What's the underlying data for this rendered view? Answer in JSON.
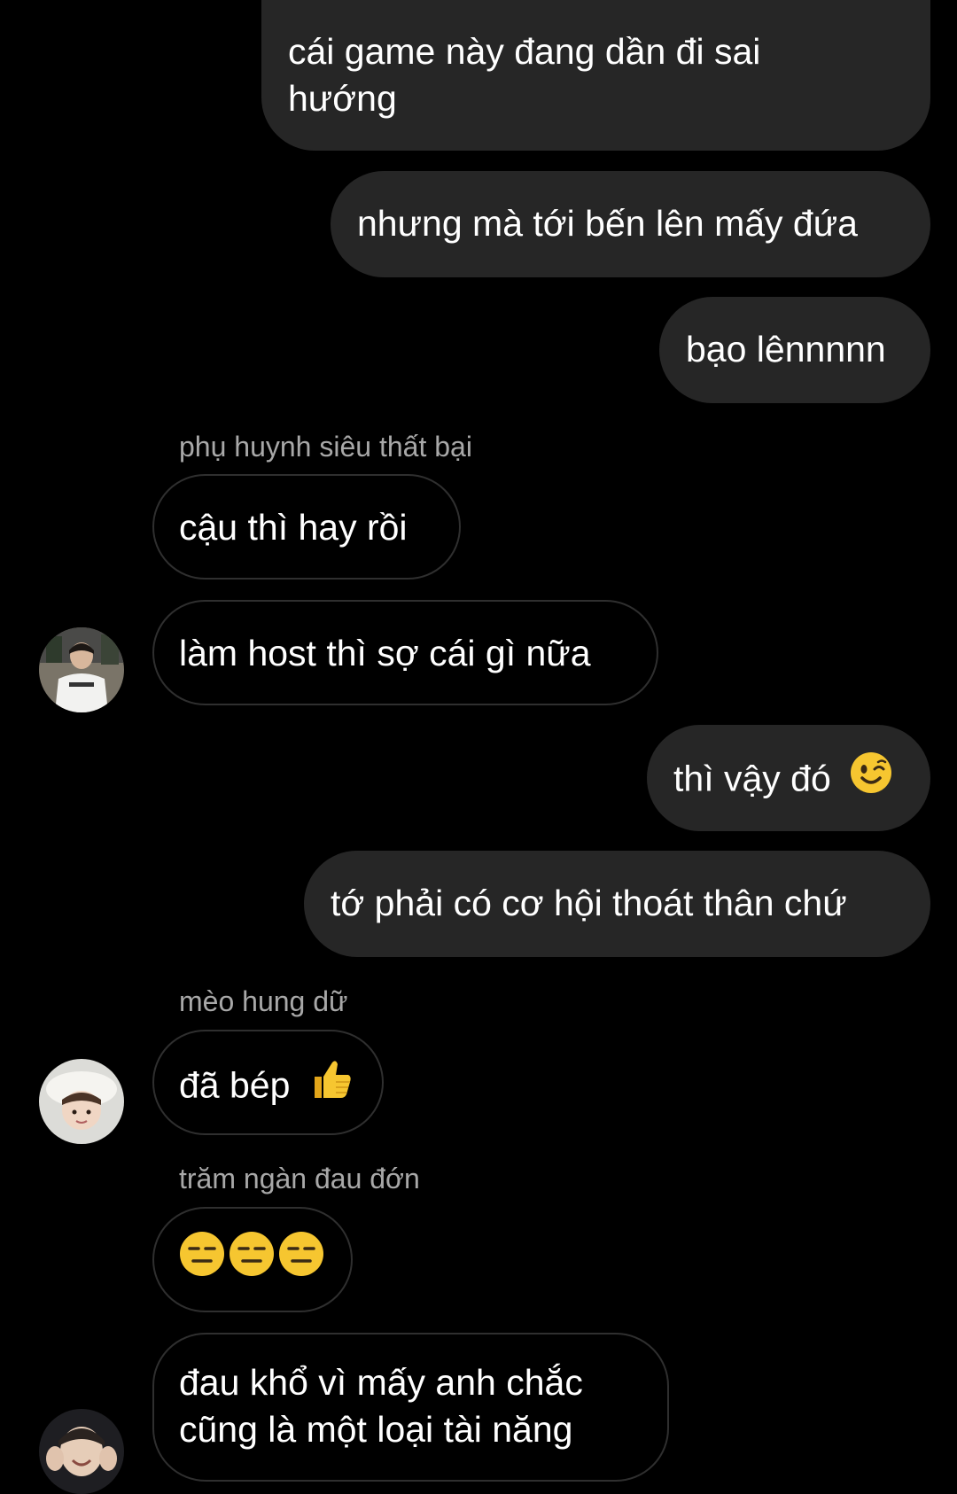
{
  "messages": [
    {
      "id": "m1",
      "from": "me",
      "text": "cái game này đang dần đi sai hướng",
      "lines": [
        "cái game này đang dần đi sai",
        "hướng"
      ]
    },
    {
      "id": "m2",
      "from": "me",
      "text": "nhưng mà tới bến lên mấy đứa"
    },
    {
      "id": "m3",
      "from": "me",
      "text": "bạo lênnnnn"
    },
    {
      "id": "s1",
      "sender": "phụ huynh siêu thất bại"
    },
    {
      "id": "m4",
      "from": "them",
      "text": "cậu thì hay rồi"
    },
    {
      "id": "m5",
      "from": "them",
      "text": "làm host thì sợ cái gì nữa"
    },
    {
      "id": "m6",
      "from": "me",
      "text": "thì vậy đó",
      "emoji": "winking-face"
    },
    {
      "id": "m7",
      "from": "me",
      "text": "tớ phải có cơ hội thoát thân chứ"
    },
    {
      "id": "s2",
      "sender": "mèo hung dữ"
    },
    {
      "id": "m8",
      "from": "them",
      "text": "đã bép",
      "emoji": "thumbs-up"
    },
    {
      "id": "s3",
      "sender": "trăm ngàn đau đớn"
    },
    {
      "id": "m9",
      "from": "them",
      "emojis": [
        "expressionless-face",
        "expressionless-face",
        "expressionless-face"
      ]
    },
    {
      "id": "m10",
      "from": "them",
      "text": "đau khổ vì mấy anh chắc cũng là một loại tài năng",
      "lines": [
        "đau khổ vì mấy anh chắc",
        "cũng là một loại tài năng"
      ]
    }
  ],
  "chat": {
    "m1_line1": "cái game này đang dần đi sai",
    "m1_line2": "hướng",
    "m2": "nhưng mà tới bến lên mấy đứa",
    "m3": "bạo lênnnnn",
    "sender1": "phụ huynh siêu thất bại",
    "m4": "cậu thì hay rồi",
    "m5": "làm host thì sợ cái gì nữa",
    "m6": "thì vậy đó",
    "m7": "tớ phải có cơ hội thoát thân chứ",
    "sender2": "mèo hung dữ",
    "m8": "đã bép",
    "sender3": "trăm ngàn đau đớn",
    "m10_line1": "đau khổ vì mấy anh chắc",
    "m10_line2": "cũng là một loại tài năng"
  },
  "colors": {
    "background": "#000000",
    "my_bubble": "#262626",
    "their_bubble_border": "#2f2f2f",
    "sender_name": "#a8a8a8",
    "emoji_yellow": "#f6c630"
  },
  "avatars": [
    "avatar-photo-white-tshirt",
    "avatar-photo-white-hat",
    "avatar-photo-hands-face"
  ]
}
